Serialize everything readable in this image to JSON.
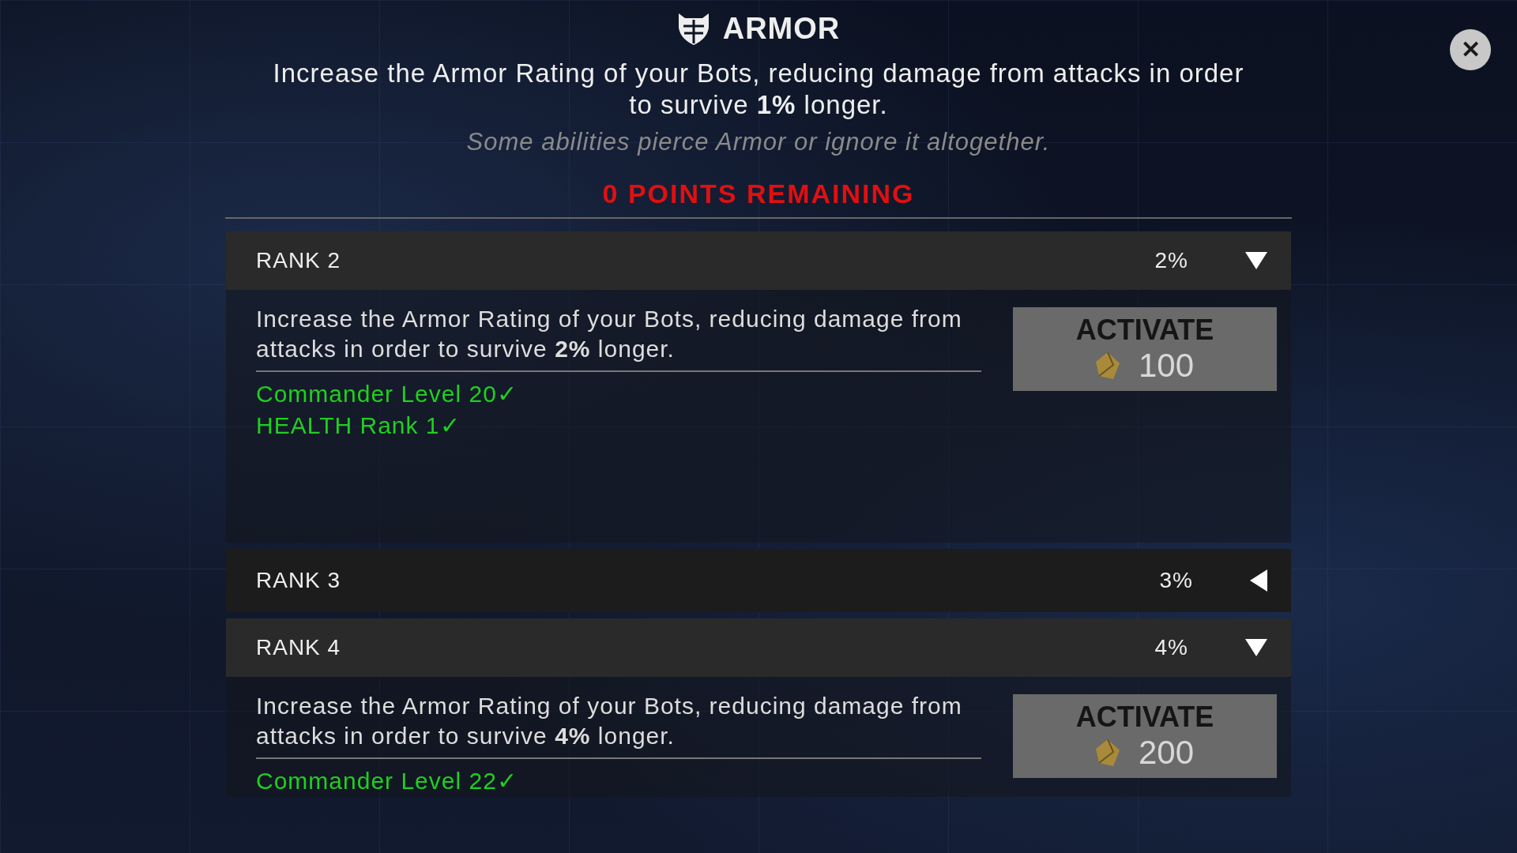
{
  "header": {
    "title": "ARMOR",
    "description": "Increase the Armor Rating of your Bots, reducing damage from attacks in order to survive **1%** longer.",
    "note": "Some abilities pierce Armor or ignore it altogether.",
    "points": "0 POINTS REMAINING"
  },
  "close": {
    "label": "✕"
  },
  "ranks": [
    {
      "title": "RANK 2",
      "percent": "2%",
      "expanded": true,
      "description": "Increase the Armor Rating of your Bots, reducing damage from attacks in order to survive **2%** longer.",
      "requirements": [
        {
          "text": "Commander Level 20✓",
          "met": true
        },
        {
          "text": "HEALTH Rank 1✓",
          "met": true
        }
      ],
      "button": {
        "label": "ACTIVATE",
        "cost": "100",
        "disabled": true
      }
    },
    {
      "title": "RANK 3",
      "percent": "3%",
      "expanded": false
    },
    {
      "title": "RANK 4",
      "percent": "4%",
      "expanded": true,
      "description": "Increase the Armor Rating of your Bots, reducing damage from attacks in order to survive **4%** longer.",
      "requirements": [
        {
          "text": "Commander Level 22✓",
          "met": true
        }
      ],
      "button": {
        "label": "ACTIVATE",
        "cost": "200",
        "disabled": true
      }
    }
  ]
}
